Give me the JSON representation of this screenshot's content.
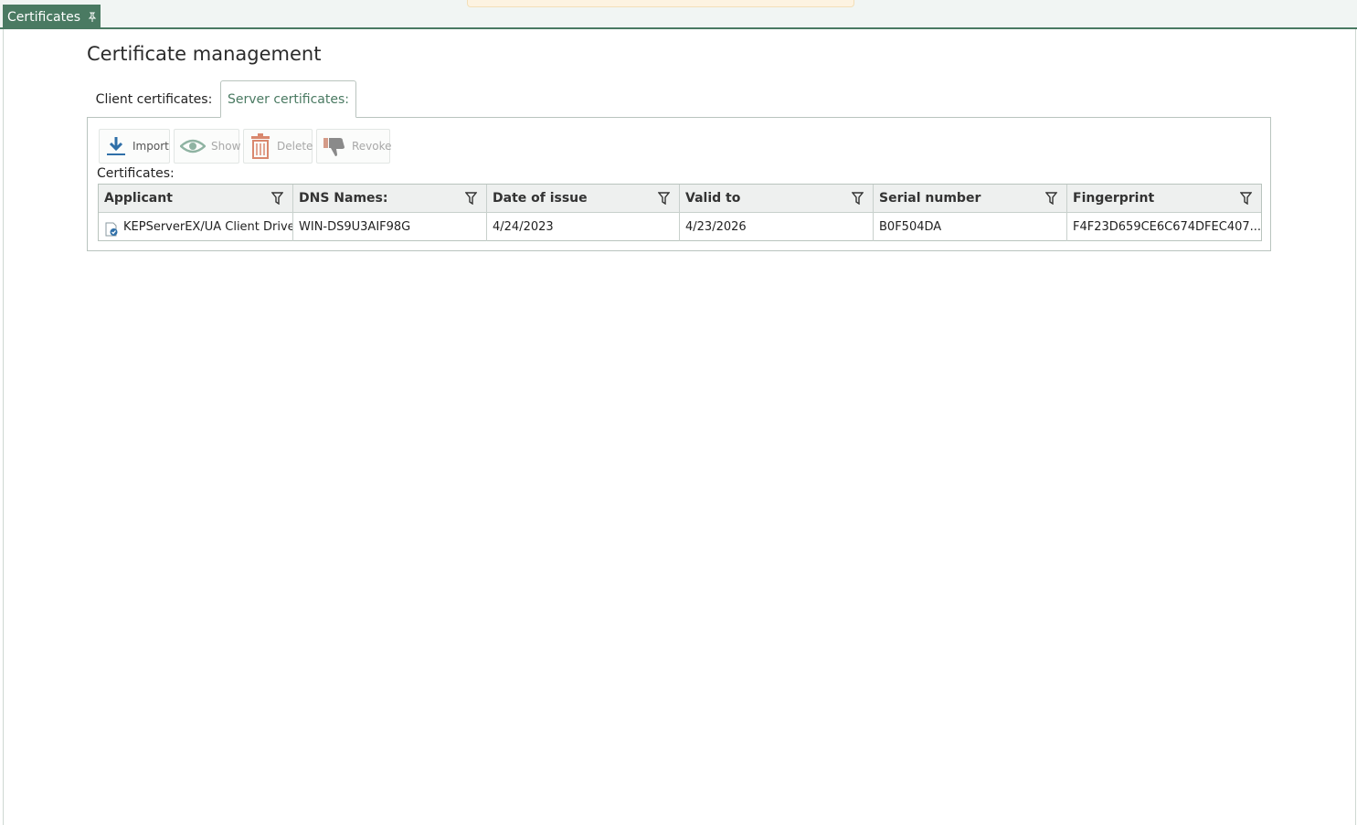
{
  "doc_tab": {
    "label": "Certificates"
  },
  "page": {
    "title": "Certificate management"
  },
  "tabs": [
    {
      "label": "Client certificates:"
    },
    {
      "label": "Server certificates:",
      "active": true
    }
  ],
  "toolbar": {
    "import_label": "Import",
    "show_label": "Show",
    "delete_label": "Delete",
    "revoke_label": "Revoke"
  },
  "section": {
    "label": "Certificates:"
  },
  "table": {
    "columns": [
      "Applicant",
      "DNS Names:",
      "Date of issue",
      "Valid to",
      "Serial number",
      "Fingerprint"
    ],
    "rows": [
      {
        "applicant": "KEPServerEX/UA Client Driver",
        "dns": "WIN-DS9U3AIF98G",
        "issued": "4/24/2023",
        "valid_to": "4/23/2026",
        "serial": "B0F504DA",
        "fingerprint": "F4F23D659CE6C674DFEC407..."
      }
    ]
  },
  "colors": {
    "accent": "#4a7a62",
    "import_icon": "#2f6fa8",
    "delete_icon": "#d9886e",
    "disabled_text": "#a8a8a8"
  },
  "icons": {
    "doc_tab": "pin-icon",
    "import": "download-icon",
    "show": "eye-icon",
    "delete": "trash-icon",
    "revoke": "thumbs-down-icon",
    "filter": "filter-icon",
    "row": "certificate-icon"
  }
}
